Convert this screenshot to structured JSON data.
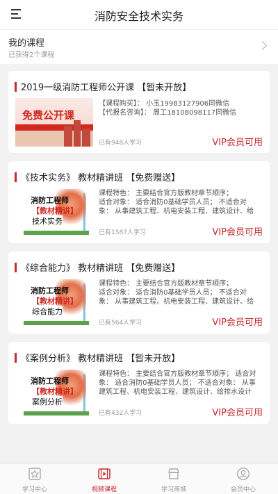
{
  "header": {
    "title": "消防安全技术实务",
    "menu_icon": "menu-icon"
  },
  "my_course": {
    "title": "我的课程",
    "subtitle": "已获得2个课程"
  },
  "courses": [
    {
      "title": "2019一级消防工程师公开课 【暂未开放】",
      "thumb_text": "免费公开课",
      "lines": [
        "【课程购买】： 小玉19983127906同微信",
        "【代报名咨询】： 周工18108098117同微信"
      ],
      "learners": "已有948人学习",
      "vip": "VIP会员可用"
    },
    {
      "title": "《技术实务》 教材精讲班 【免费赠送】",
      "thumb_lines": [
        "消防工程师",
        "【教材精讲】",
        "技术实务"
      ],
      "lines": [
        "课程特色： 主要结合官方版教材章节顺序；",
        "适合对象： 适合消防0基础学员人员； 不适合对",
        "象： 从事建筑工程、机电安装工程、建筑设计、给"
      ],
      "learners": "已有1587人学习",
      "vip": "VIP会员可用"
    },
    {
      "title": "《综合能力》 教材精讲班 【免费赠送】",
      "thumb_lines": [
        "消防工程师",
        "【教材精讲】",
        "综合能力"
      ],
      "lines": [
        "课程特色： 主要结合官方版教材章节顺序；",
        "适合对象： 适合消防0基础学员人员； 不适合对",
        "象： 从事建筑工程、机电安装工程、建筑设计、给"
      ],
      "learners": "已有564人学习",
      "vip": "VIP会员可用"
    },
    {
      "title": "《案例分析》 教材精讲班 【暂未开放】",
      "thumb_lines": [
        "消防工程师",
        "【教材精讲】",
        "案例分析"
      ],
      "lines": [
        "课程特色： 主要结合官方版教材章节顺序； 适合对",
        "象： 适合消防0基础学员人员； 不适合对象： 从事",
        "建筑工程、机电安装工程、建筑设计、给排水设计"
      ],
      "learners": "已有432人学习",
      "vip": "VIP会员可用"
    }
  ],
  "tabs": [
    {
      "label": "学习中心",
      "icon": "star-icon"
    },
    {
      "label": "视频课程",
      "icon": "video-icon",
      "active": true
    },
    {
      "label": "学习商城",
      "icon": "shop-icon"
    },
    {
      "label": "会员中心",
      "icon": "user-icon"
    }
  ],
  "colors": {
    "accent": "#c8272c",
    "background": "#f2f2f2"
  }
}
